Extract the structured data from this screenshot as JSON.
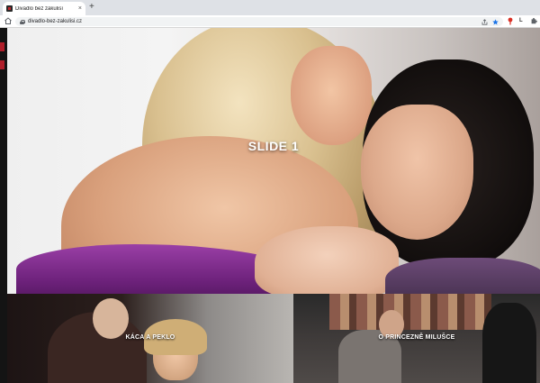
{
  "browser": {
    "tab_title": "Divadlo bez zákulisí",
    "tab_close": "×",
    "new_tab": "+",
    "url": "divadlo-bez-zakulisi.cz",
    "ext_profile": "L"
  },
  "slider": {
    "title": "SLIDE 1"
  },
  "tiles": [
    {
      "label": "KÁCA A PEKLO"
    },
    {
      "label": "O PRINCEZNĚ MILUŠCE"
    }
  ],
  "colors": {
    "accent_red": "#b01e2a",
    "star_blue": "#1a73e8"
  }
}
